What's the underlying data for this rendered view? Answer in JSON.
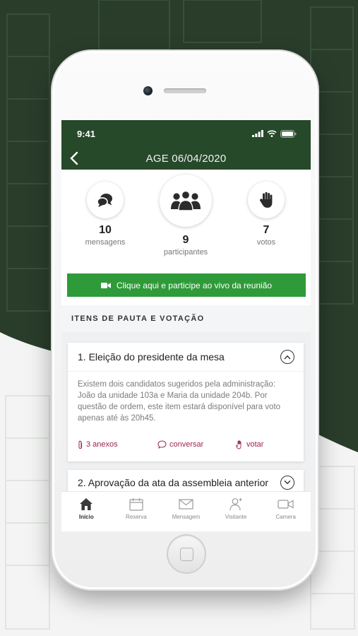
{
  "colors": {
    "header_green": "#26492a",
    "live_button_green": "#2f9a3a",
    "action_color": "#9b2352",
    "background_dark": "#2a3d2b"
  },
  "status_bar": {
    "time": "9:41",
    "icons": [
      "signal-icon",
      "wifi-icon",
      "battery-icon"
    ]
  },
  "header": {
    "back_icon": "chevron-left-icon",
    "title": "AGE 06/04/2020"
  },
  "stats": [
    {
      "icon": "chat-bubbles-icon",
      "value": "10",
      "label": "mensagens"
    },
    {
      "icon": "group-icon",
      "value": "9",
      "label": "participantes"
    },
    {
      "icon": "raised-hand-icon",
      "value": "7",
      "label": "votos"
    }
  ],
  "live_button": {
    "icon": "video-camera-icon",
    "label": "Clique aqui e participe ao vivo da reunião"
  },
  "section": {
    "title": "ITENS DE PAUTA E VOTAÇÃO"
  },
  "items": [
    {
      "title": "1. Eleição do presidente da mesa",
      "expanded": true,
      "description": "Existem dois candidatos sugeridos pela administração: João da unidade 103a e Maria da unidade 204b. Por questão de ordem, este item estará disponível para voto apenas até às 20h45.",
      "actions": [
        {
          "icon": "paperclip-icon",
          "label": "3  anexos"
        },
        {
          "icon": "chat-icon",
          "label": "conversar"
        },
        {
          "icon": "hand-icon",
          "label": "votar"
        }
      ]
    },
    {
      "title": "2. Aprovação da ata da assembleia anterior",
      "expanded": false
    }
  ],
  "tabs": [
    {
      "icon": "home-icon",
      "label": "Início",
      "active": true
    },
    {
      "icon": "calendar-icon",
      "label": "Reserva",
      "active": false
    },
    {
      "icon": "envelope-icon",
      "label": "Mensagem",
      "active": false
    },
    {
      "icon": "visitor-icon",
      "label": "Visitante",
      "active": false
    },
    {
      "icon": "camera-icon",
      "label": "Camera",
      "active": false
    }
  ]
}
